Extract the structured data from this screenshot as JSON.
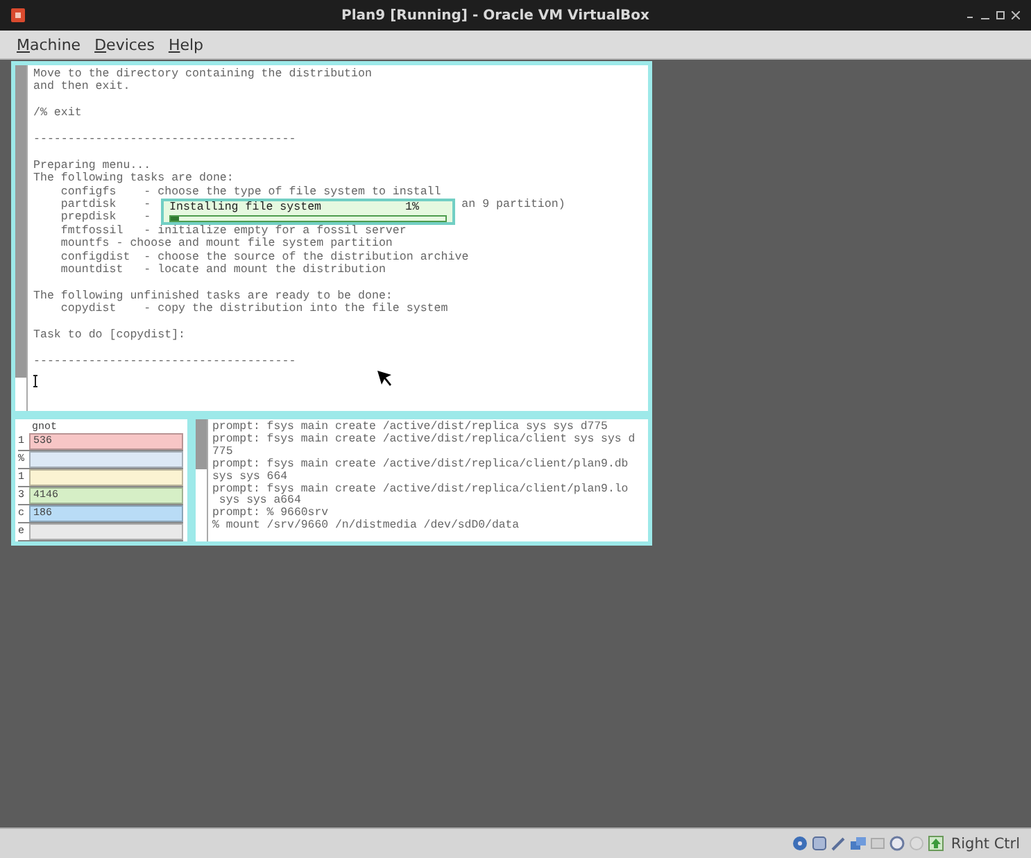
{
  "window": {
    "title": "Plan9 [Running] - Oracle VM VirtualBox"
  },
  "menu": [
    "Machine",
    "Devices",
    "Help"
  ],
  "main_terminal": {
    "paragraphs": [
      [
        "Move to the directory containing the distribution",
        "and then exit."
      ],
      [
        "/% exit"
      ],
      [
        "--------------------------------------"
      ],
      [
        {
          "text": "Preparing menu..."
        },
        {
          "text": "The following tasks are done:"
        },
        {
          "text": "    configfs    - choose the type of file system to install"
        },
        {
          "text": "    partdisk    -",
          "tail": "an 9 partition)"
        },
        {
          "text": "    prepdisk    -"
        },
        {
          "text": "    fmtfossil   - initialize empty for a fossil server"
        },
        {
          "text": "    mountfs - choose and mount file system partition"
        },
        {
          "text": "    configdist  - choose the source of the distribution archive"
        },
        {
          "text": "    mountdist   - locate and mount the distribution"
        }
      ],
      [
        "The following unfinished tasks are ready to be done:",
        "    copydist    - copy the distribution into the file system"
      ],
      [
        "Task to do [copydist]:"
      ],
      [
        "--------------------------------------"
      ]
    ],
    "progress": {
      "label": "Installing file system",
      "reading": "1%",
      "level": 0.01
    }
  },
  "stats": {
    "title": "gnot",
    "rows": [
      {
        "key": "1",
        "value": "536",
        "color": "#f7c6c6"
      },
      {
        "key": "%",
        "color": "#dce8f5"
      },
      {
        "key": "1",
        "color": "#fbf3d2"
      },
      {
        "key": "3",
        "value": "4146",
        "color": "#d6efc6"
      },
      {
        "key": "c",
        "value": "186",
        "color": "#b9dcf6"
      },
      {
        "key": "e",
        "color": "#e9e9e9"
      }
    ]
  },
  "second_terminal": {
    "lines": [
      "prompt: fsys main create /active/dist/replica sys sys d775",
      "prompt: fsys main create /active/dist/replica/client sys sys d",
      "775",
      "prompt: fsys main create /active/dist/replica/client/plan9.db",
      "sys sys 664",
      "prompt: fsys main create /active/dist/replica/client/plan9.lo",
      " sys sys a664",
      "prompt: % 9660srv",
      "% mount /srv/9660 /n/distmedia /dev/sdD0/data"
    ]
  },
  "status_bar": {
    "host_key": "Right Ctrl"
  }
}
